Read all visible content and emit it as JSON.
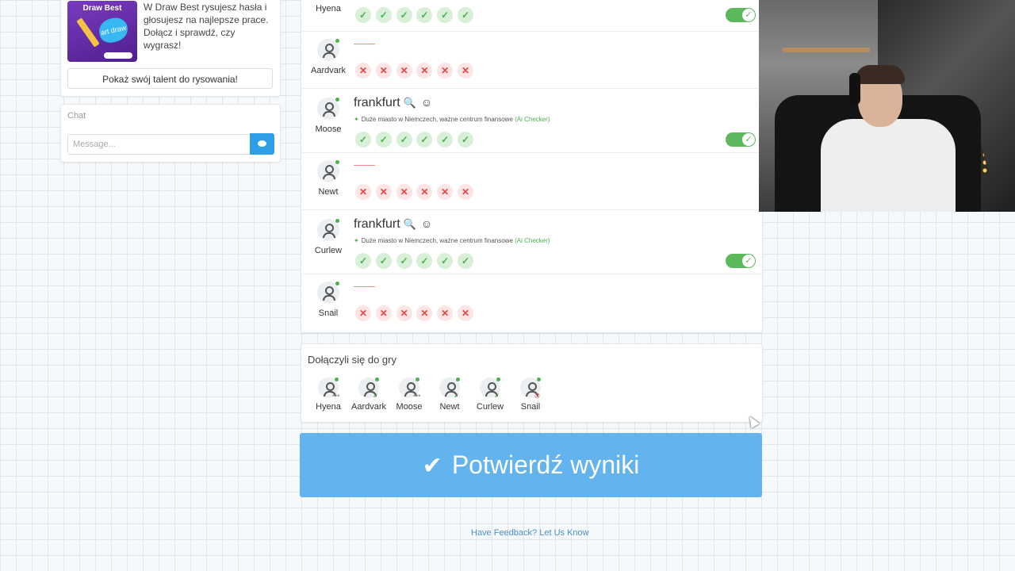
{
  "promo": {
    "thumb_title": "Draw Best",
    "thumb_blob": "art draw",
    "text": "W Draw Best rysujesz hasła i głosujesz na najlepsze prace. Dołącz i sprawdź, czy wygrasz!",
    "button_label": "Pokaż swój talent do rysowania!"
  },
  "chat": {
    "title": "Chat",
    "placeholder": "Message..."
  },
  "results": {
    "rows": [
      {
        "name": "Hyena",
        "word": "",
        "hint": "",
        "marks": "ok",
        "toggle": true
      },
      {
        "name": "Aardvark",
        "word": "",
        "hint": "",
        "marks": "bad",
        "toggle": false
      },
      {
        "name": "Moose",
        "word": "frankfurt",
        "hint": "Duże miasto w Niemczech, ważne centrum finansowe",
        "hint_source": "(Ai Checker)",
        "marks": "ok",
        "toggle": true
      },
      {
        "name": "Newt",
        "word": "",
        "hint": "",
        "marks": "bad",
        "toggle": false
      },
      {
        "name": "Curlew",
        "word": "frankfurt",
        "hint": "Duże miasto w Niemczech, ważne centrum finansowe",
        "hint_source": "(Ai Checker)",
        "marks": "ok",
        "toggle": true
      },
      {
        "name": "Snail",
        "word": "",
        "hint": "",
        "marks": "bad",
        "toggle": false
      }
    ]
  },
  "joined": {
    "title": "Dołączyli się do gry",
    "players": [
      {
        "name": "Hyena",
        "status": "waiting"
      },
      {
        "name": "Aardvark",
        "status": "confirmed"
      },
      {
        "name": "Moose",
        "status": "waiting"
      },
      {
        "name": "Newt",
        "status": "confirmed"
      },
      {
        "name": "Curlew",
        "status": "confirmed"
      },
      {
        "name": "Snail",
        "status": "timeout"
      }
    ]
  },
  "confirm": {
    "label": "Potwierdź wyniki"
  },
  "feedback": {
    "label": "Have Feedback? Let Us Know"
  },
  "colors": {
    "accent": "#62b3ee",
    "ok": "#4caf50",
    "bad": "#e54545",
    "toggle": "#5cb85c"
  }
}
